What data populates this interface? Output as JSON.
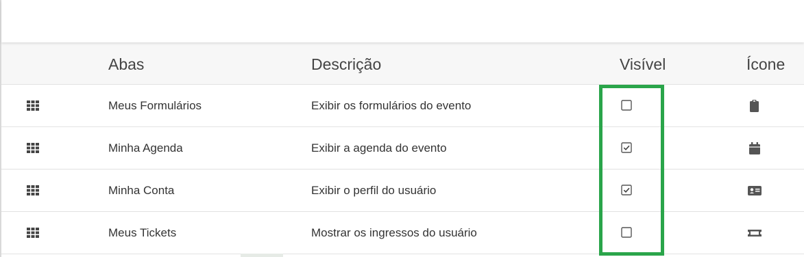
{
  "table": {
    "headers": {
      "abas": "Abas",
      "descricao": "Descrição",
      "visivel": "Visível",
      "icone": "Ícone"
    },
    "rows": [
      {
        "aba": "Meus Formulários",
        "descricao": "Exibir os formulários do evento",
        "visivel": false,
        "icon": "clipboard-icon"
      },
      {
        "aba": "Minha Agenda",
        "descricao": "Exibir a agenda do evento",
        "visivel": true,
        "icon": "calendar-icon"
      },
      {
        "aba": "Minha Conta",
        "descricao": "Exibir o perfil do usuário",
        "visivel": true,
        "icon": "id-card-icon"
      },
      {
        "aba": "Meus Tickets",
        "descricao": "Mostrar os ingressos do usuário",
        "visivel": false,
        "icon": "ticket-icon"
      }
    ]
  },
  "colors": {
    "highlight": "#2aa54a",
    "header_bg": "#f7f7f7",
    "icon": "#555555"
  }
}
